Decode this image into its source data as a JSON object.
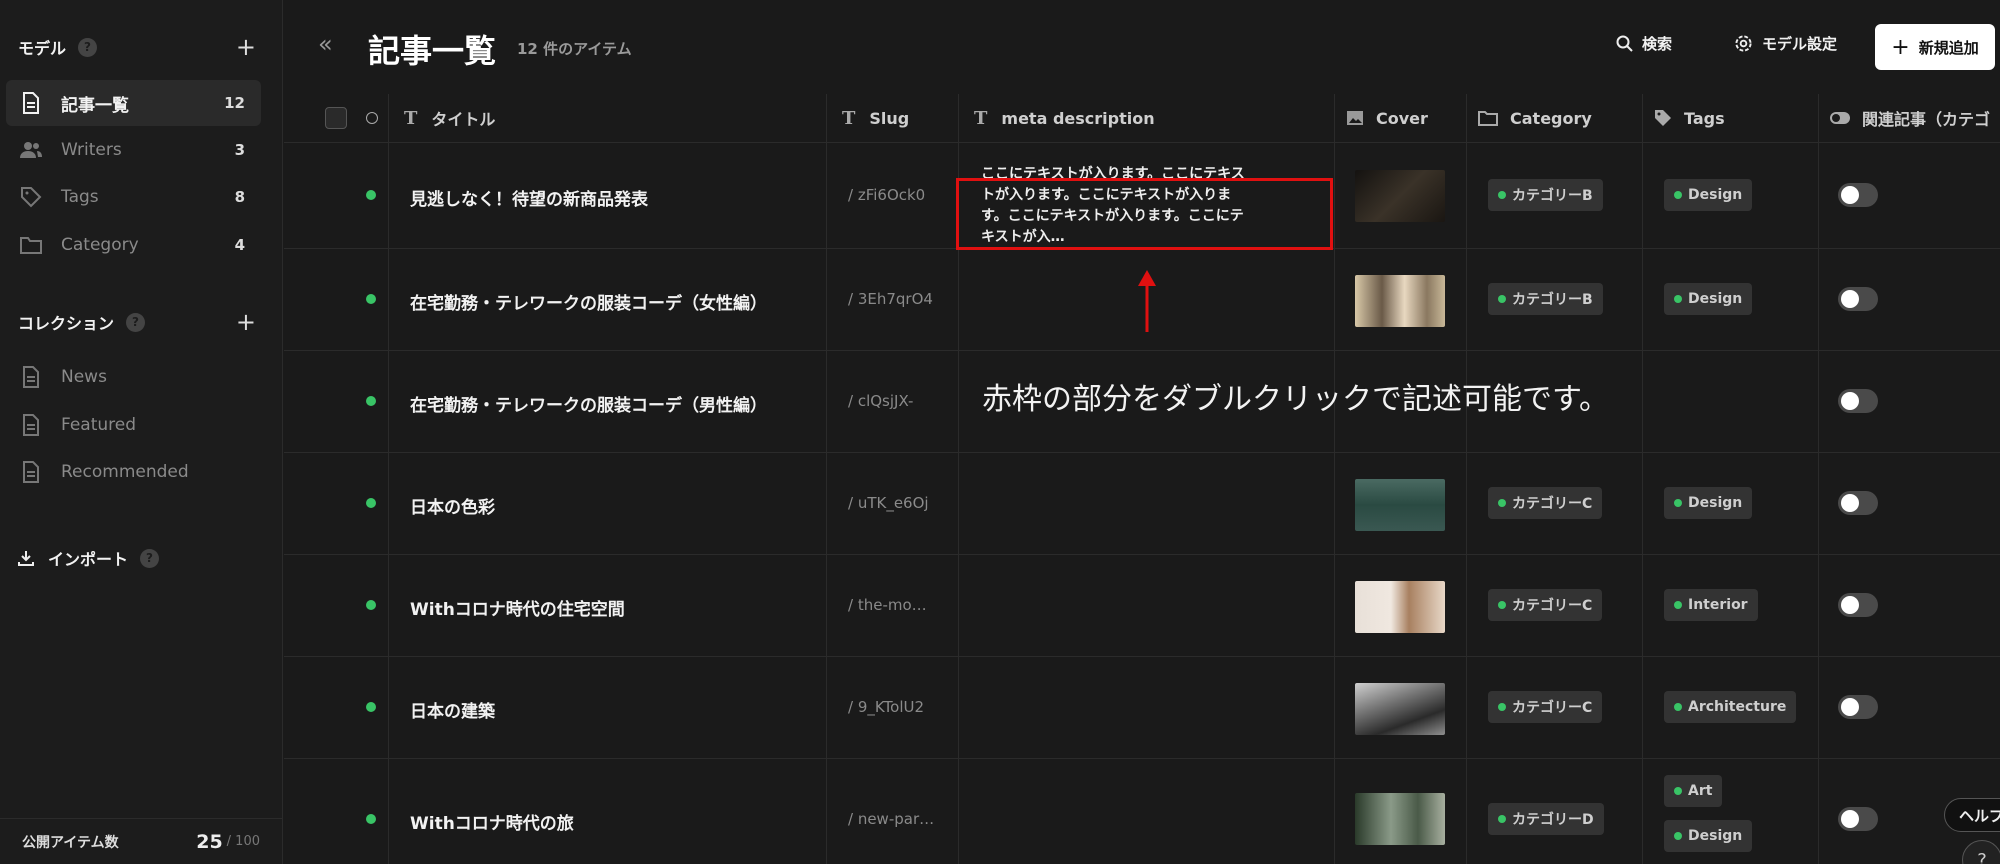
{
  "sidebar": {
    "models_title": "モデル",
    "models": [
      {
        "label": "記事一覧",
        "count": "12",
        "icon": "document-icon"
      },
      {
        "label": "Writers",
        "count": "3",
        "icon": "users-icon"
      },
      {
        "label": "Tags",
        "count": "8",
        "icon": "tag-icon"
      },
      {
        "label": "Category",
        "count": "4",
        "icon": "folder-icon"
      }
    ],
    "collections_title": "コレクション",
    "collections": [
      {
        "label": "News",
        "icon": "document-icon"
      },
      {
        "label": "Featured",
        "icon": "document-icon"
      },
      {
        "label": "Recommended",
        "icon": "document-icon"
      }
    ],
    "import_label": "インポート",
    "public_items_label": "公開アイテム数",
    "public_items_count": "25",
    "public_items_total": "/ 100",
    "help_glyph": "?",
    "plus_glyph": "+"
  },
  "header": {
    "title": "記事一覧",
    "count": "12 件のアイテム",
    "search_label": "検索",
    "model_settings_label": "モデル設定",
    "new_label": "新規追加",
    "collapse_glyph": "«"
  },
  "columns": {
    "title": "タイトル",
    "slug": "Slug",
    "meta": "meta description",
    "cover": "Cover",
    "category": "Category",
    "tags": "Tags",
    "related": "関連記事（カテゴ"
  },
  "rows": [
    {
      "title": "見逃しなく！待望の新商品発表",
      "slug": "/ zFi6Ock0",
      "meta": "ここにテキストが入ります。ここにテキストが入ります。ここにテキストが入ります。ここにテキストが入ります。ここにテキストが入…",
      "category": "カテゴリーB",
      "tags": [
        "Design"
      ],
      "cover": "#2a2520"
    },
    {
      "title": "在宅勤務・テレワークの服装コーデ（女性編）",
      "slug": "/ 3Eh7qrO4",
      "meta": "",
      "category": "カテゴリーB",
      "tags": [
        "Design"
      ],
      "cover": "#a89880"
    },
    {
      "title": "在宅勤務・テレワークの服装コーデ（男性編）",
      "slug": "/ clQsjJX-",
      "meta": "",
      "category": "",
      "tags": [],
      "cover": ""
    },
    {
      "title": "日本の色彩",
      "slug": "/ uTK_e6Oj",
      "meta": "",
      "category": "カテゴリーC",
      "tags": [
        "Design"
      ],
      "cover": "#3a5a52"
    },
    {
      "title": "Withコロナ時代の住宅空間",
      "slug": "/ the-mo…",
      "meta": "",
      "category": "カテゴリーC",
      "tags": [
        "Interior"
      ],
      "cover": "#b8a090"
    },
    {
      "title": "日本の建築",
      "slug": "/ 9_KTolU2",
      "meta": "",
      "category": "カテゴリーC",
      "tags": [
        "Architecture"
      ],
      "cover": "#8a8a8a"
    },
    {
      "title": "Withコロナ時代の旅",
      "slug": "/ new-par…",
      "meta": "",
      "category": "カテゴリーD",
      "tags": [
        "Art",
        "Design"
      ],
      "cover": "#5a6a5a"
    }
  ],
  "annotation": "赤枠の部分をダブルクリックで記述可能です。",
  "help_fab": "ヘルプ",
  "question_fab": "?",
  "colors": {
    "accent_green": "#39c466",
    "highlight_red": "#e01010"
  }
}
